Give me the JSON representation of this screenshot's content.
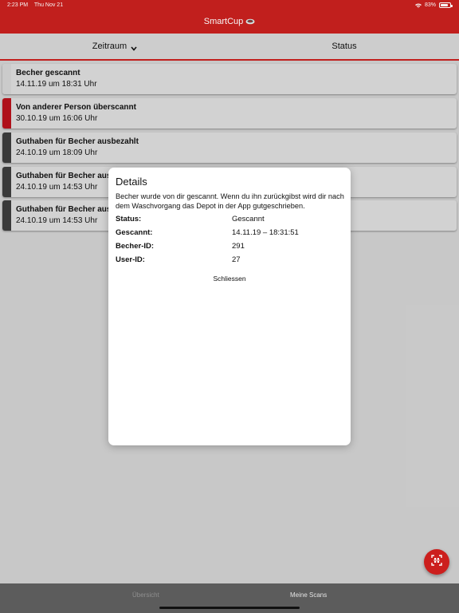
{
  "status_bar": {
    "time": "2:23 PM",
    "date": "Thu Nov 21",
    "battery": "83%"
  },
  "header": {
    "title": "SmartCup"
  },
  "filters": {
    "zeitraum_label": "Zeitraum",
    "status_label": "Status"
  },
  "colors": {
    "accent": "#c8201e",
    "stripe_gray": "#d2d2d2",
    "stripe_red": "#b5121b",
    "stripe_dark": "#3c3c3c"
  },
  "scans": [
    {
      "title": "Becher gescannt",
      "date": "14.11.19 um 18:31 Uhr",
      "stripe": "gray"
    },
    {
      "title": "Von anderer Person überscannt",
      "date": "30.10.19 um 16:06 Uhr",
      "stripe": "red"
    },
    {
      "title": "Guthaben für Becher ausbezahlt",
      "date": "24.10.19 um 18:09 Uhr",
      "stripe": "dark"
    },
    {
      "title": "Guthaben für Becher ausbezahlt",
      "date": "24.10.19 um 14:53 Uhr",
      "stripe": "dark"
    },
    {
      "title": "Guthaben für Becher ausbezahlt",
      "date": "24.10.19 um 14:53 Uhr",
      "stripe": "dark"
    }
  ],
  "modal": {
    "title": "Details",
    "description": "Becher wurde von dir gescannt. Wenn du ihn zurückgibst wird dir nach dem Waschvorgang das Depot in der App gutgeschrieben.",
    "rows": [
      {
        "label": "Status:",
        "value": "Gescannt"
      },
      {
        "label": "Gescannt:",
        "value": "14.11.19 – 18:31:51"
      },
      {
        "label": "Becher-ID:",
        "value": "291"
      },
      {
        "label": "User-ID:",
        "value": "27"
      }
    ],
    "close_label": "Schliessen"
  },
  "tabs": {
    "uebersicht": "Übersicht",
    "meine_scans": "Meine Scans"
  },
  "icons": {
    "fab": "qr-scan-icon",
    "filter": "chevron-down-icon",
    "logo": "cup-logo-icon"
  }
}
